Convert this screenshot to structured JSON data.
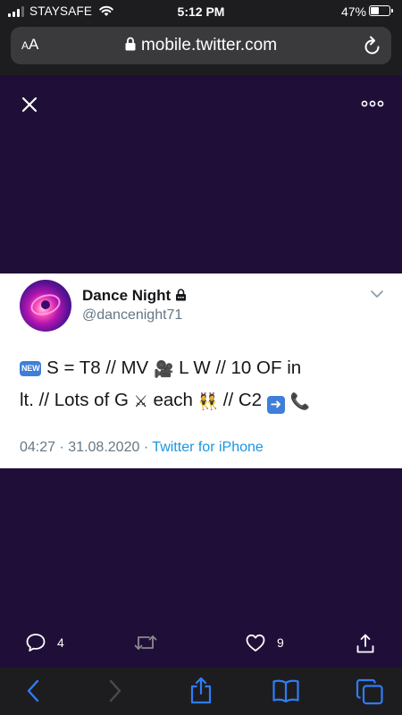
{
  "status_bar": {
    "carrier": "STAYSAFE",
    "time": "5:12 PM",
    "battery": "47%",
    "battery_level": 0.47
  },
  "browser": {
    "text_size_label_small": "A",
    "text_size_label_large": "A",
    "url": "mobile.twitter.com",
    "icons": [
      "lock-icon",
      "reload-icon"
    ]
  },
  "media_viewer": {
    "background_color": "#1f0f38",
    "icons": [
      "close-icon",
      "more-icon"
    ]
  },
  "tweet": {
    "display_name": "Dance Night",
    "handle": "@dancenight71",
    "text": {
      "new_badge": "NEW",
      "line1_a": "S = T8 // MV",
      "line1_b": "L W // 10 OF in",
      "line2_a": "lt. // Lots of G",
      "line2_b": "each",
      "line2_c": "// C2",
      "emoji": [
        "new-badge",
        "movie-camera",
        "crossed-swords",
        "dancers",
        "right-arrow",
        "telephone"
      ]
    },
    "time": "04:27",
    "date": "31.08.2020",
    "separator": "·",
    "source": "Twitter for iPhone"
  },
  "actions": {
    "reply_count": "4",
    "like_count": "9",
    "icons": [
      "reply-icon",
      "retweet-icon",
      "like-icon",
      "share-icon"
    ]
  },
  "toolbar": {
    "icons": [
      "back-icon",
      "forward-icon",
      "share-icon",
      "bookmarks-icon",
      "tabs-icon"
    ],
    "accent_color": "#2f7cf6"
  }
}
